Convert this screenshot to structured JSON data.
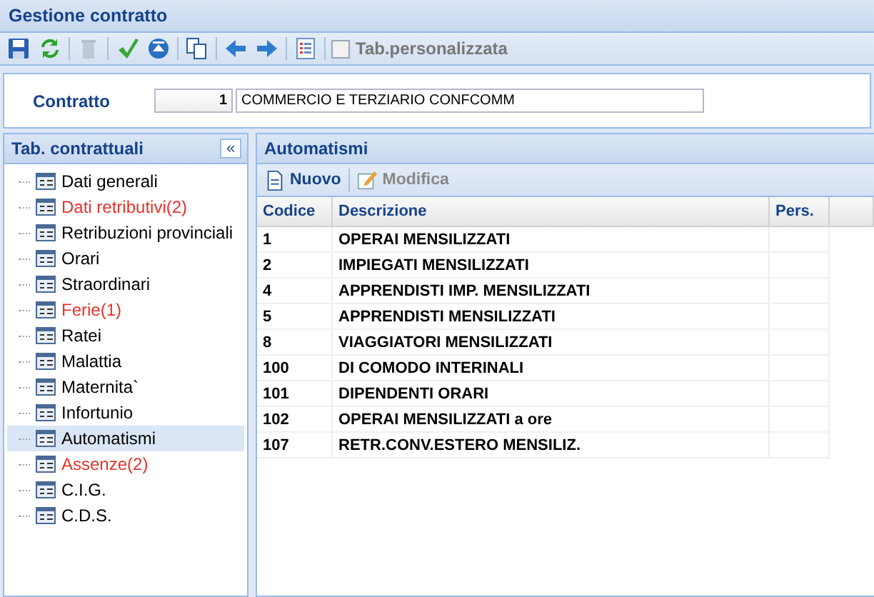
{
  "window": {
    "title": "Gestione contratto"
  },
  "toolbar": {
    "buttons": [
      {
        "kind": "save",
        "disabled": false
      },
      {
        "kind": "refresh",
        "disabled": false
      },
      {
        "kind": "delete",
        "disabled": true
      },
      {
        "kind": "confirm",
        "disabled": false
      },
      {
        "kind": "up",
        "disabled": false
      },
      {
        "kind": "copy",
        "disabled": false
      },
      {
        "kind": "back",
        "disabled": false
      },
      {
        "kind": "forward",
        "disabled": false
      },
      {
        "kind": "list",
        "disabled": false
      }
    ],
    "checkbox": {
      "label": "Tab.personalizzata",
      "checked": false
    }
  },
  "form": {
    "label": "Contratto",
    "code": "1",
    "description": "COMMERCIO E TERZIARIO CONFCOMM"
  },
  "sidebar": {
    "title": "Tab. contrattuali",
    "collapse": "«",
    "items": [
      {
        "label": "Dati generali",
        "flagged": false,
        "selected": false
      },
      {
        "label": "Dati retributivi(2)",
        "flagged": true,
        "selected": false
      },
      {
        "label": "Retribuzioni provinciali",
        "flagged": false,
        "selected": false
      },
      {
        "label": "Orari",
        "flagged": false,
        "selected": false
      },
      {
        "label": "Straordinari",
        "flagged": false,
        "selected": false
      },
      {
        "label": "Ferie(1)",
        "flagged": true,
        "selected": false
      },
      {
        "label": "Ratei",
        "flagged": false,
        "selected": false
      },
      {
        "label": "Malattia",
        "flagged": false,
        "selected": false
      },
      {
        "label": "Maternita`",
        "flagged": false,
        "selected": false
      },
      {
        "label": "Infortunio",
        "flagged": false,
        "selected": false
      },
      {
        "label": "Automatismi",
        "flagged": false,
        "selected": true
      },
      {
        "label": "Assenze(2)",
        "flagged": true,
        "selected": false
      },
      {
        "label": "C.I.G.",
        "flagged": false,
        "selected": false
      },
      {
        "label": "C.D.S.",
        "flagged": false,
        "selected": false
      }
    ]
  },
  "panel": {
    "title": "Automatismi",
    "actions": [
      {
        "kind": "new",
        "label": "Nuovo",
        "disabled": false
      },
      {
        "kind": "edit",
        "label": "Modifica",
        "disabled": true
      }
    ],
    "table": {
      "columns": [
        "Codice",
        "Descrizione",
        "Pers."
      ],
      "rows": [
        [
          "1",
          "OPERAI MENSILIZZATI"
        ],
        [
          "2",
          "IMPIEGATI MENSILIZZATI"
        ],
        [
          "4",
          "APPRENDISTI IMP. MENSILIZZATI"
        ],
        [
          "5",
          "APPRENDISTI MENSILIZZATI"
        ],
        [
          "8",
          "VIAGGIATORI MENSILIZZATI"
        ],
        [
          "100",
          "DI COMODO INTERINALI"
        ],
        [
          "101",
          "DIPENDENTI ORARI"
        ],
        [
          "102",
          "OPERAI MENSILIZZATI a ore"
        ],
        [
          "107",
          "RETR.CONV.ESTERO MENSILIZ."
        ]
      ]
    }
  }
}
